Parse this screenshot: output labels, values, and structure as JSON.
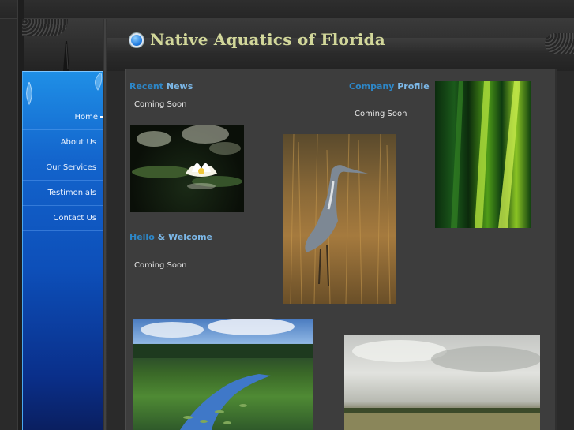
{
  "site": {
    "title": "Native Aquatics of Florida"
  },
  "nav": {
    "items": [
      {
        "label": "Home"
      },
      {
        "label": "About Us"
      },
      {
        "label": "Our Services"
      },
      {
        "label": "Testimonials"
      },
      {
        "label": "Contact Us"
      }
    ]
  },
  "sections": {
    "recent_news": {
      "title_part1": "Recent",
      "title_part2": "News",
      "body": "Coming Soon"
    },
    "company_profile": {
      "title_part1": "Company",
      "title_part2": "Profile",
      "body": "Coming Soon"
    },
    "hello_welcome": {
      "title_part1": "Hello",
      "title_part2": "& Welcome",
      "body": "Coming Soon"
    }
  },
  "images": {
    "water_lily": "water-lily-photo",
    "heron": "heron-photo",
    "reeds": "green-reeds-photo",
    "river_marsh": "river-marsh-photo",
    "prairie": "wet-prairie-photo"
  },
  "colors": {
    "title": "#d2d79a",
    "heading_dark_blue": "#2d87c8",
    "heading_light_blue": "#7cb8e8",
    "sidebar_blue": "#1364cc"
  }
}
